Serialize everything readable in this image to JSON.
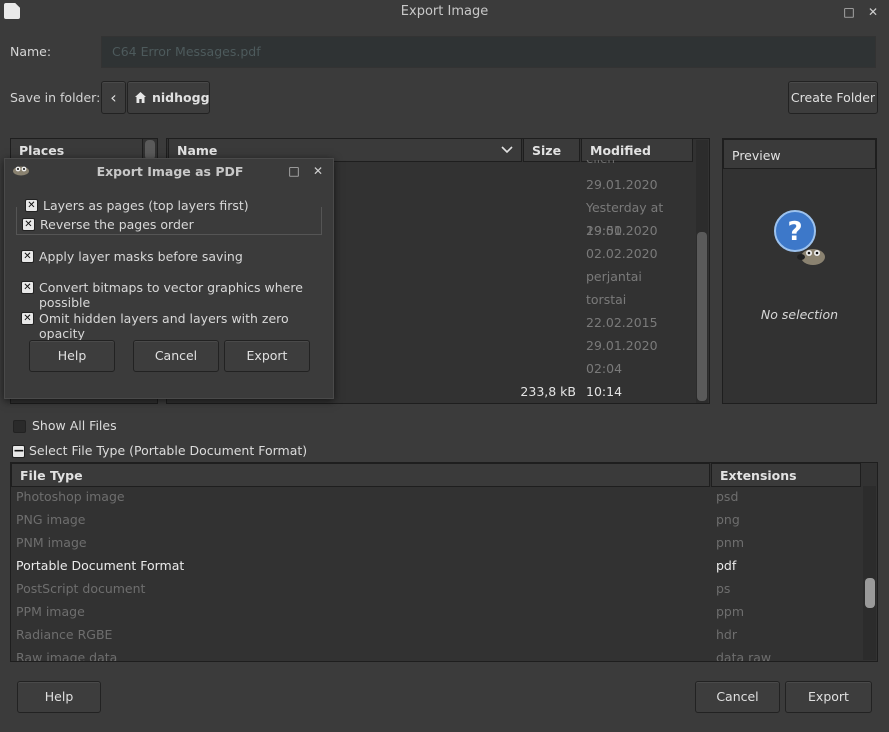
{
  "window": {
    "title": "Export Image",
    "maximize_glyph": "□",
    "close_glyph": "✕"
  },
  "name_label": "Name:",
  "name_value": "C64 Error Messages.pdf",
  "save_in_label": "Save in folder:",
  "breadcrumb": {
    "back_glyph": "‹",
    "folder": "nidhogg"
  },
  "create_folder_label": "Create Folder",
  "places_header": "Places",
  "file_list": {
    "headers": {
      "name": "Name",
      "size": "Size",
      "modified": "Modified"
    },
    "partial_top": "eilen",
    "modified": [
      "29.01.2020",
      "Yesterday at 19:50",
      "29.01.2020",
      "02.02.2020",
      "perjantai",
      "torstai",
      "22.02.2015",
      "29.01.2020",
      "02:04"
    ],
    "selected": {
      "size": "233,8 kB",
      "modified": "10:14"
    }
  },
  "preview": {
    "header": "Preview",
    "no_selection": "No selection"
  },
  "show_all_files_label": "Show All Files",
  "select_file_type_label": "Select File Type (Portable Document Format)",
  "file_types": {
    "headers": {
      "type": "File Type",
      "ext": "Extensions"
    },
    "rows": [
      {
        "type": "Photoshop image",
        "ext": "psd"
      },
      {
        "type": "PNG image",
        "ext": "png"
      },
      {
        "type": "PNM image",
        "ext": "pnm"
      },
      {
        "type": "Portable Document Format",
        "ext": "pdf"
      },
      {
        "type": "PostScript document",
        "ext": "ps"
      },
      {
        "type": "PPM image",
        "ext": "ppm"
      },
      {
        "type": "Radiance RGBE",
        "ext": "hdr"
      },
      {
        "type": "Raw image data",
        "ext": "data raw"
      }
    ]
  },
  "bottom_buttons": {
    "help": "Help",
    "cancel": "Cancel",
    "export": "Export"
  },
  "dialog": {
    "title": "Export Image as PDF",
    "maximize_glyph": "□",
    "close_glyph": "✕",
    "options": [
      "Layers as pages (top layers first)",
      "Reverse the pages order",
      "Apply layer masks before saving",
      "Convert bitmaps to vector graphics where possible",
      "Omit hidden layers and layers with zero opacity"
    ],
    "check_glyph": "✕",
    "buttons": {
      "help": "Help",
      "cancel": "Cancel",
      "export": "Export"
    }
  }
}
